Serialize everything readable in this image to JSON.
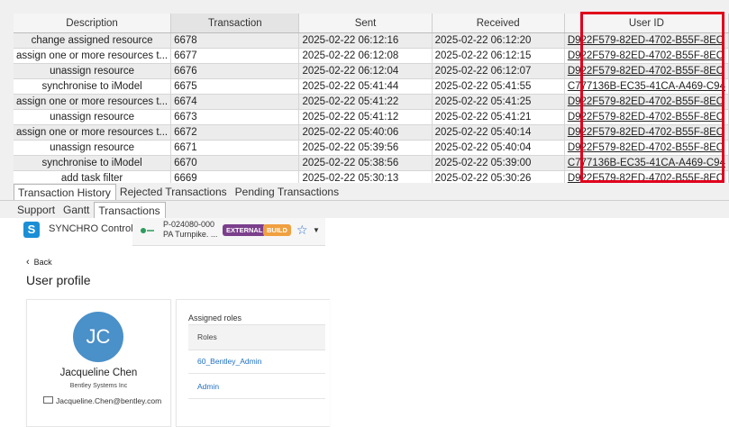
{
  "grid": {
    "columns": [
      "Description",
      "Transaction",
      "Sent",
      "Received",
      "User ID"
    ],
    "rows": [
      {
        "description": "change assigned resource",
        "transaction": "6678",
        "sent": "2025-02-22 06:12:16",
        "received": "2025-02-22 06:12:20",
        "user_id": "D922F579-82ED-4702-B55F-8EC"
      },
      {
        "description": "assign one or more resources t...",
        "transaction": "6677",
        "sent": "2025-02-22 06:12:08",
        "received": "2025-02-22 06:12:15",
        "user_id": "D922F579-82ED-4702-B55F-8EC"
      },
      {
        "description": "unassign resource",
        "transaction": "6676",
        "sent": "2025-02-22 06:12:04",
        "received": "2025-02-22 06:12:07",
        "user_id": "D922F579-82ED-4702-B55F-8EC"
      },
      {
        "description": "synchronise to iModel",
        "transaction": "6675",
        "sent": "2025-02-22 05:41:44",
        "received": "2025-02-22 05:41:55",
        "user_id": "C777136B-EC35-41CA-A469-C94"
      },
      {
        "description": "assign one or more resources t...",
        "transaction": "6674",
        "sent": "2025-02-22 05:41:22",
        "received": "2025-02-22 05:41:25",
        "user_id": "D922F579-82ED-4702-B55F-8EC"
      },
      {
        "description": "unassign resource",
        "transaction": "6673",
        "sent": "2025-02-22 05:41:12",
        "received": "2025-02-22 05:41:21",
        "user_id": "D922F579-82ED-4702-B55F-8EC"
      },
      {
        "description": "assign one or more resources t...",
        "transaction": "6672",
        "sent": "2025-02-22 05:40:06",
        "received": "2025-02-22 05:40:14",
        "user_id": "D922F579-82ED-4702-B55F-8EC"
      },
      {
        "description": "unassign resource",
        "transaction": "6671",
        "sent": "2025-02-22 05:39:56",
        "received": "2025-02-22 05:40:04",
        "user_id": "D922F579-82ED-4702-B55F-8EC"
      },
      {
        "description": "synchronise to iModel",
        "transaction": "6670",
        "sent": "2025-02-22 05:38:56",
        "received": "2025-02-22 05:39:00",
        "user_id": "C777136B-EC35-41CA-A469-C94"
      },
      {
        "description": "add task filter",
        "transaction": "6669",
        "sent": "2025-02-22 05:30:13",
        "received": "2025-02-22 05:30:26",
        "user_id": "D922F579-82ED-4702-B55F-8EC"
      }
    ],
    "highlight_color": "#e0001b"
  },
  "tabs_bottom": [
    "Transaction History",
    "Rejected Transactions",
    "Pending Transactions"
  ],
  "tabs_bottom_active": "Transaction History",
  "tabs_panel": [
    "Support",
    "Gantt",
    "Transactions"
  ],
  "tabs_panel_active": "Transactions",
  "app": {
    "name": "SYNCHRO Control",
    "project_code": "P-024080-000",
    "project_name": "PA Turnpike. ...",
    "badge_external": "EXTERNAL",
    "badge_build": "BUILD",
    "back_label": "Back",
    "page_title": "User profile"
  },
  "profile": {
    "initials": "JC",
    "name": "Jacqueline Chen",
    "organization": "Bentley Systems Inc",
    "email": "Jacqueline.Chen@bentley.com",
    "avatar_color": "#4a90c9"
  },
  "roles": {
    "title": "Assigned roles",
    "column": "Roles",
    "items": [
      "60_Bentley_Admin",
      "Admin"
    ]
  }
}
